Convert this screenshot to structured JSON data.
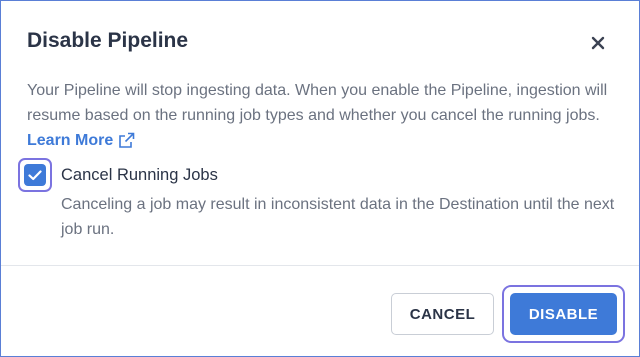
{
  "dialog": {
    "title": "Disable Pipeline",
    "close_icon": "close-icon",
    "description": "Your Pipeline will stop ingesting data. When you enable the Pipeline, ingestion will resume based on the running job types and whether you cancel the running jobs.",
    "learn_more_label": "Learn More",
    "learn_more_icon": "external-link-icon",
    "checkbox": {
      "checked": true,
      "label": "Cancel Running Jobs",
      "help": "Canceling a job may result in inconsistent data in the Destination until the next job run."
    },
    "buttons": {
      "cancel_label": "CANCEL",
      "disable_label": "DISABLE"
    }
  },
  "colors": {
    "accent": "#3e7ad8",
    "focus_ring": "#7b73e0",
    "title": "#2b3447",
    "muted_text": "#6b7280"
  }
}
